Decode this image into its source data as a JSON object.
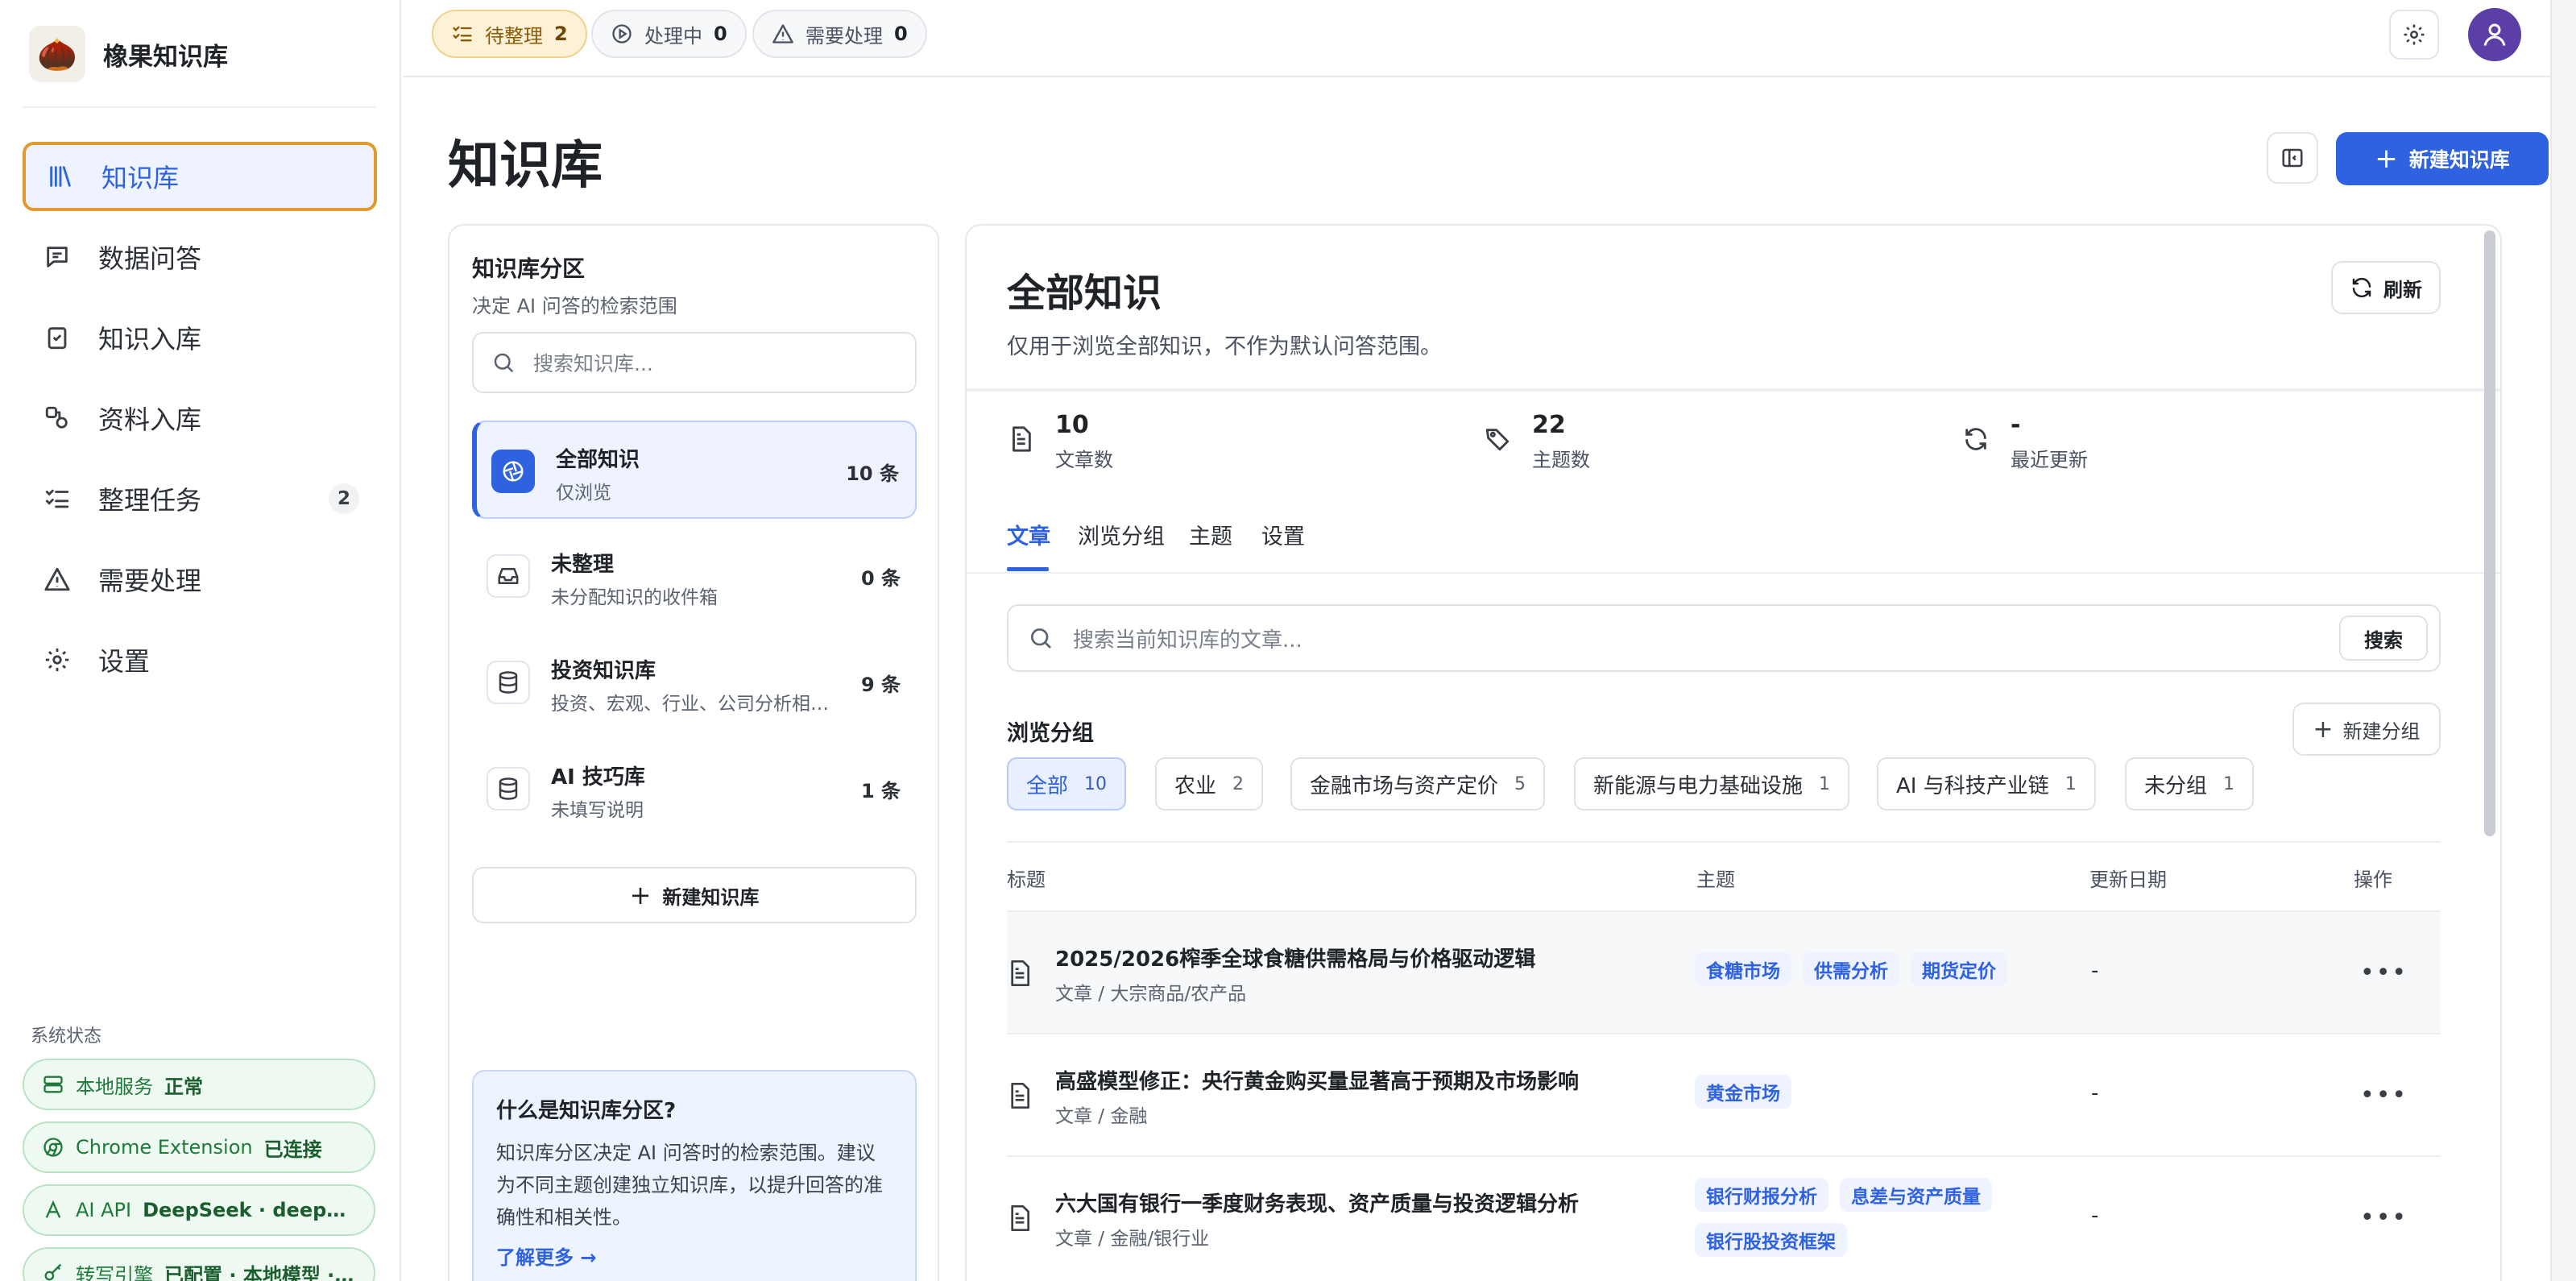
{
  "app": {
    "name": "橡果知识库"
  },
  "sidebar": {
    "nav": [
      {
        "label": "知识库",
        "icon": "library-icon",
        "active": true
      },
      {
        "label": "数据问答",
        "icon": "chat-icon"
      },
      {
        "label": "知识入库",
        "icon": "clipboard-check-icon"
      },
      {
        "label": "资料入库",
        "icon": "link-shapes-icon"
      },
      {
        "label": "整理任务",
        "icon": "list-check-icon",
        "badge": "2"
      },
      {
        "label": "需要处理",
        "icon": "warning-icon"
      },
      {
        "label": "设置",
        "icon": "gear-icon"
      }
    ],
    "system_label": "系统状态",
    "system": [
      {
        "name": "本地服务",
        "value": "正常"
      },
      {
        "name": "Chrome Extension",
        "value": "已连接"
      },
      {
        "name": "AI API",
        "value": "DeepSeek · deepseek-chat"
      },
      {
        "name": "转写引擎",
        "value": "已配置 · 本地模型 · whisper"
      }
    ]
  },
  "topbar": {
    "pills": [
      {
        "label": "待整理",
        "count": "2"
      },
      {
        "label": "处理中",
        "count": "0"
      },
      {
        "label": "需要处理",
        "count": "0"
      }
    ]
  },
  "page": {
    "title": "知识库",
    "new_kb_label": "新建知识库"
  },
  "kb_panel": {
    "title": "知识库分区",
    "subtitle": "决定 AI 问答的检索范围",
    "search_placeholder": "搜索知识库...",
    "items": [
      {
        "name": "全部知识",
        "desc": "仅浏览",
        "count": "10 条"
      },
      {
        "name": "未整理",
        "desc": "未分配知识的收件箱",
        "count": "0 条"
      },
      {
        "name": "投资知识库",
        "desc": "投资、宏观、行业、公司分析相关资料",
        "count": "9 条"
      },
      {
        "name": "AI 技巧库",
        "desc": "未填写说明",
        "count": "1 条"
      }
    ],
    "new_label": "新建知识库",
    "help": {
      "title": "什么是知识库分区?",
      "text": "知识库分区决定 AI 问答时的检索范围。建议为不同主题创建独立知识库，以提升回答的准确性和相关性。",
      "link": "了解更多 →"
    }
  },
  "main": {
    "title": "全部知识",
    "subtitle": "仅用于浏览全部知识，不作为默认问答范围。",
    "refresh_label": "刷新",
    "stats": [
      {
        "value": "10",
        "label": "文章数"
      },
      {
        "value": "22",
        "label": "主题数"
      },
      {
        "value": "-",
        "label": "最近更新"
      }
    ],
    "tabs": [
      "文章",
      "浏览分组",
      "主题",
      "设置"
    ],
    "search_placeholder": "搜索当前知识库的文章...",
    "search_button": "搜索",
    "group_title": "浏览分组",
    "new_group_label": "新建分组",
    "groups": [
      {
        "label": "全部",
        "count": "10"
      },
      {
        "label": "农业",
        "count": "2"
      },
      {
        "label": "金融市场与资产定价",
        "count": "5"
      },
      {
        "label": "新能源与电力基础设施",
        "count": "1"
      },
      {
        "label": "AI 与科技产业链",
        "count": "1"
      },
      {
        "label": "未分组",
        "count": "1"
      }
    ],
    "columns": {
      "title": "标题",
      "topics": "主题",
      "date": "更新日期",
      "actions": "操作"
    },
    "rows": [
      {
        "title": "2025/2026榨季全球食糖供需格局与价格驱动逻辑",
        "path": "文章 / 大宗商品/农产品",
        "tags": [
          "食糖市场",
          "供需分析",
          "期货定价"
        ],
        "date": "-"
      },
      {
        "title": "高盛模型修正：央行黄金购买量显著高于预期及市场影响",
        "path": "文章 / 金融",
        "tags": [
          "黄金市场"
        ],
        "date": "-"
      },
      {
        "title": "六大国有银行一季度财务表现、资产质量与投资逻辑分析",
        "path": "文章 / 金融/银行业",
        "tags": [
          "银行财报分析",
          "息差与资产质量",
          "银行股投资框架"
        ],
        "date": "-"
      }
    ]
  }
}
